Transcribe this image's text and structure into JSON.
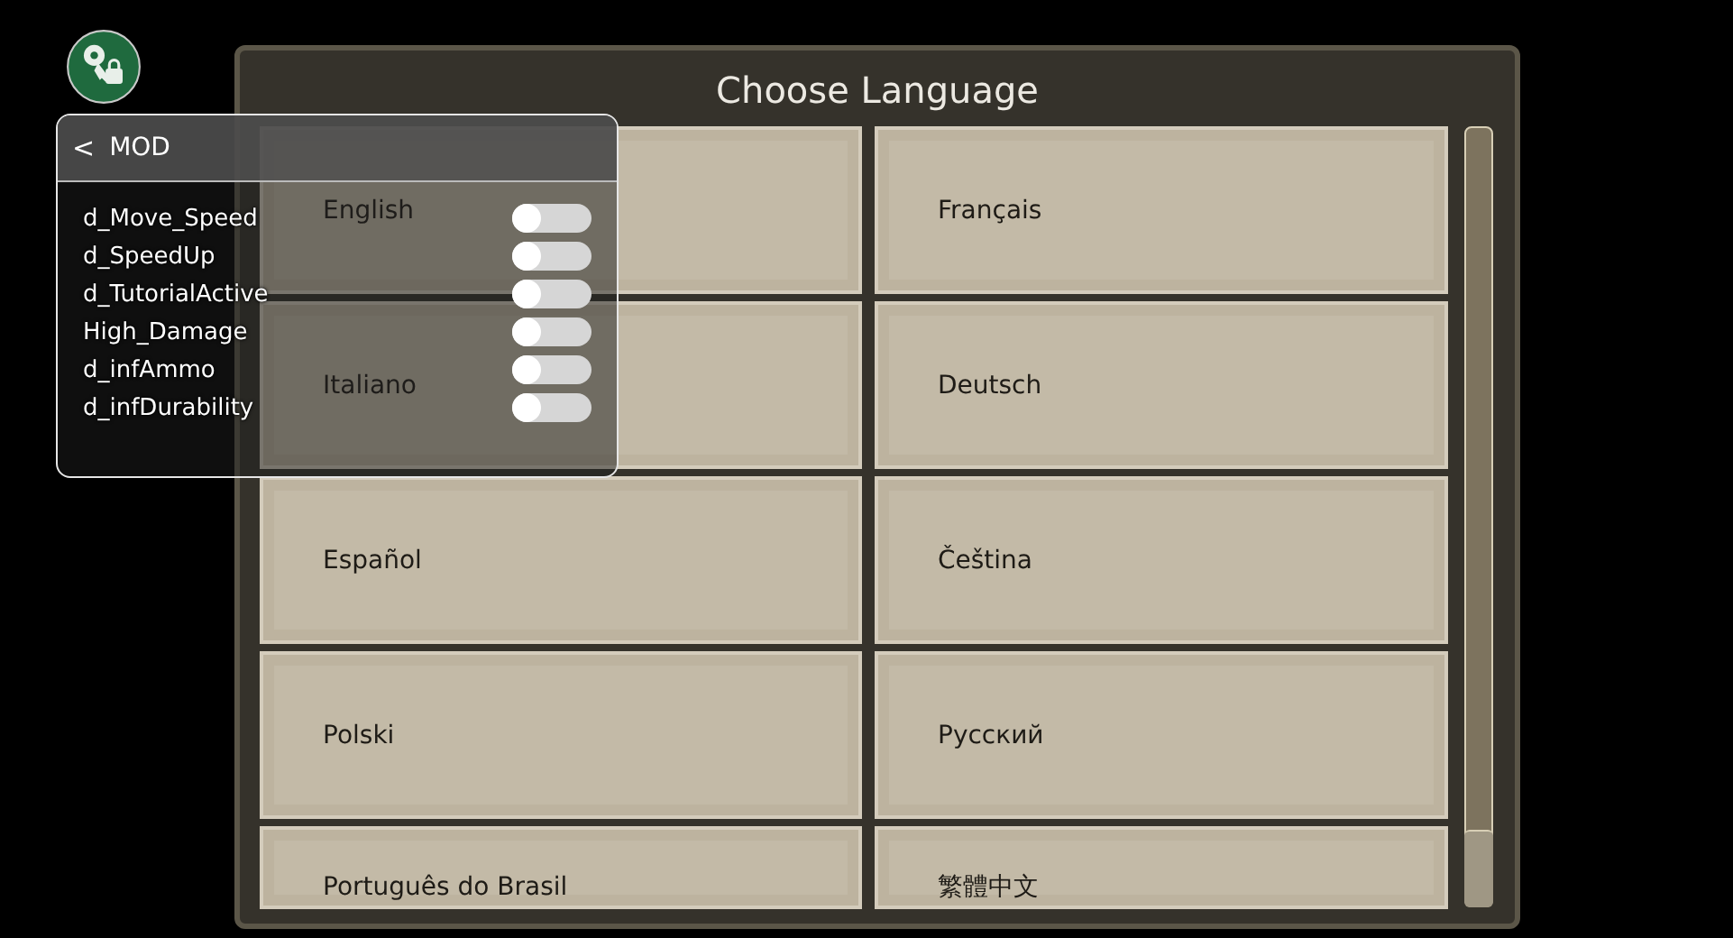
{
  "dialog": {
    "title": "Choose Language",
    "languages": [
      {
        "label": "English"
      },
      {
        "label": "Français"
      },
      {
        "label": "Italiano"
      },
      {
        "label": "Deutsch"
      },
      {
        "label": "Español"
      },
      {
        "label": "Čeština"
      },
      {
        "label": "Polski"
      },
      {
        "label": "Русский"
      },
      {
        "label": "Português do Brasil"
      },
      {
        "label": "繁體中文"
      }
    ]
  },
  "mod_menu": {
    "title": "MOD",
    "back": "<",
    "options": [
      {
        "label": "d_Move_Speed",
        "on": false
      },
      {
        "label": "d_SpeedUp",
        "on": false
      },
      {
        "label": "d_TutorialActive",
        "on": false
      },
      {
        "label": "High_Damage",
        "on": false
      },
      {
        "label": "d_infAmmo",
        "on": false
      },
      {
        "label": "d_infDurability",
        "on": false
      }
    ]
  }
}
